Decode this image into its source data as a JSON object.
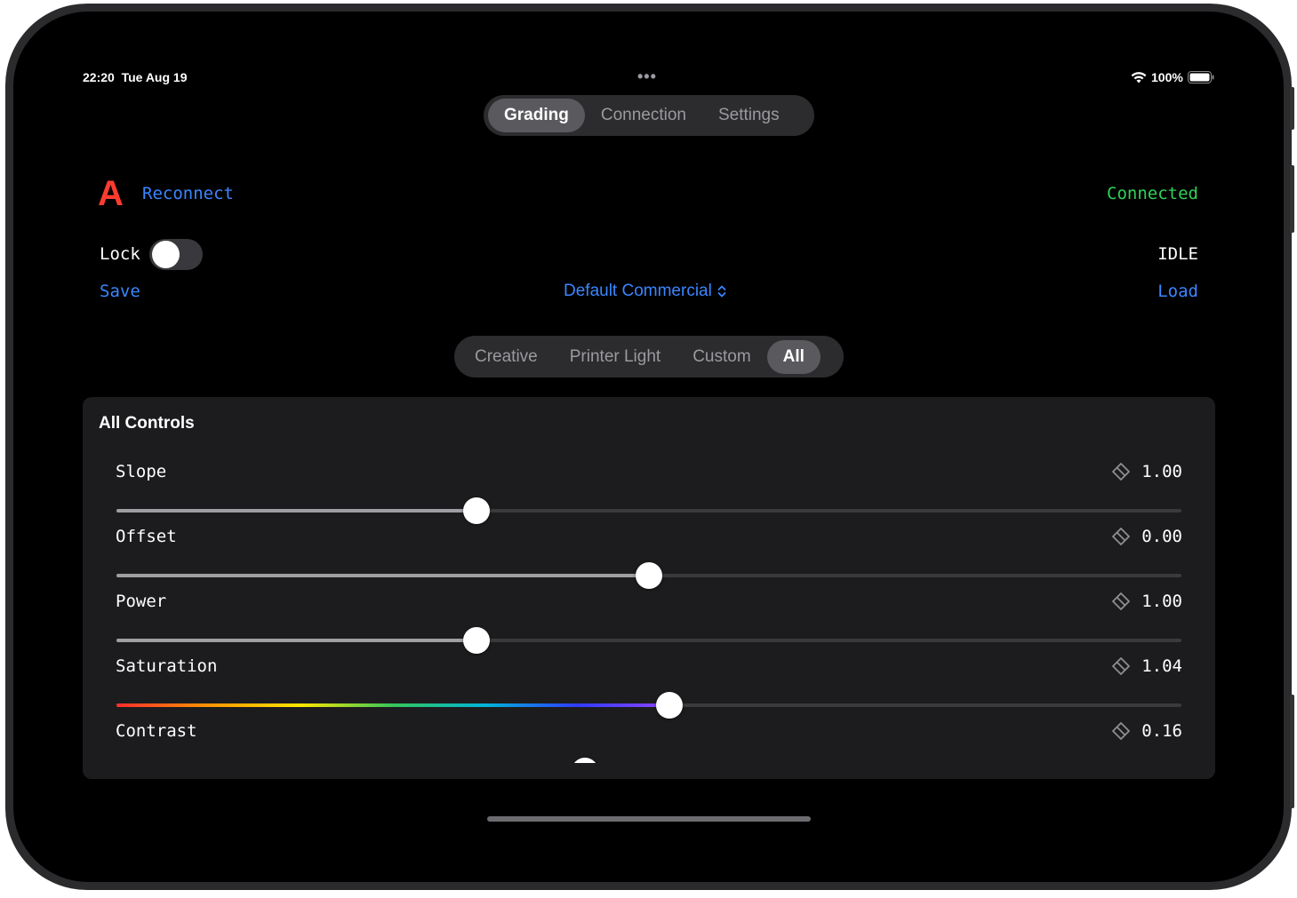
{
  "status": {
    "time": "22:20",
    "date": "Tue Aug 19",
    "battery": "100%",
    "more": "•••"
  },
  "tabs": [
    {
      "label": "Grading",
      "active": true
    },
    {
      "label": "Connection",
      "active": false
    },
    {
      "label": "Settings",
      "active": false
    }
  ],
  "header": {
    "camera_letter": "A",
    "camera_color": "#ff3b30",
    "reconnect_label": "Reconnect",
    "connection_status": "Connected",
    "connection_color": "#30d158",
    "lock_label": "Lock",
    "lock_on": false,
    "state": "IDLE",
    "save_label": "Save",
    "preset_label": "Default Commercial",
    "load_label": "Load"
  },
  "filters": [
    {
      "label": "Creative",
      "active": false
    },
    {
      "label": "Printer Light",
      "active": false
    },
    {
      "label": "Custom",
      "active": false
    },
    {
      "label": "All",
      "active": true
    }
  ],
  "panel": {
    "title": "All Controls",
    "controls": [
      {
        "label": "Slope",
        "value": "1.00",
        "position": 0.338
      },
      {
        "label": "Offset",
        "value": "0.00",
        "position": 0.5
      },
      {
        "label": "Power",
        "value": "1.00",
        "position": 0.338
      },
      {
        "label": "Saturation",
        "value": "1.04",
        "position": 0.519,
        "rainbow": true
      },
      {
        "label": "Contrast",
        "value": "0.16",
        "position": 0.44
      }
    ]
  },
  "colors": {
    "accent": "#3a86ff",
    "panel_bg": "#1c1c1e",
    "segment_bg": "#2c2c2e"
  }
}
